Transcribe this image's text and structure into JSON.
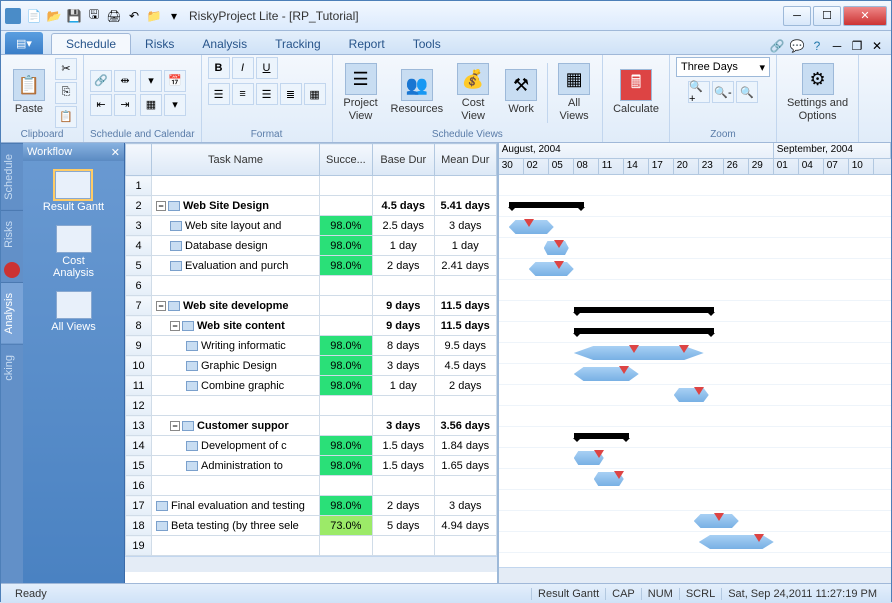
{
  "app": {
    "title": "RiskyProject Lite - [RP_Tutorial]"
  },
  "tabs": {
    "schedule": "Schedule",
    "risks": "Risks",
    "analysis": "Analysis",
    "tracking": "Tracking",
    "report": "Report",
    "tools": "Tools"
  },
  "ribbon": {
    "clipboard": {
      "paste": "Paste",
      "label": "Clipboard"
    },
    "schedcal": {
      "label": "Schedule and Calendar"
    },
    "format": {
      "label": "Format"
    },
    "views": {
      "project": "Project\nView",
      "resources": "Resources",
      "cost": "Cost\nView",
      "work": "Work",
      "all": "All\nViews",
      "label": "Schedule Views"
    },
    "calculate": "Calculate",
    "zoom": {
      "combo": "Three Days",
      "label": "Zoom"
    },
    "settings": {
      "label": "Settings and\nOptions"
    }
  },
  "workflow": {
    "title": "Workflow",
    "gantt": "Result Gantt",
    "cost": "Cost\nAnalysis",
    "all": "All Views"
  },
  "sidetabs": {
    "schedule": "Schedule",
    "risks": "Risks",
    "analysis": "Analysis",
    "cking": "cking"
  },
  "grid": {
    "headers": {
      "task": "Task Name",
      "succ": "Succe...",
      "base": "Base Dur",
      "mean": "Mean Dur"
    },
    "rows": [
      {
        "n": "1",
        "name": "",
        "succ": "",
        "base": "",
        "mean": "",
        "lvl": 0
      },
      {
        "n": "2",
        "name": "Web Site Design",
        "succ": "",
        "base": "4.5 days",
        "mean": "5.41 days",
        "lvl": 0,
        "bold": true,
        "expand": true
      },
      {
        "n": "3",
        "name": "Web site layout and",
        "succ": "98.0%",
        "base": "2.5 days",
        "mean": "3 days",
        "lvl": 1
      },
      {
        "n": "4",
        "name": "Database design",
        "succ": "98.0%",
        "base": "1 day",
        "mean": "1 day",
        "lvl": 1
      },
      {
        "n": "5",
        "name": "Evaluation and purch",
        "succ": "98.0%",
        "base": "2 days",
        "mean": "2.41 days",
        "lvl": 1
      },
      {
        "n": "6",
        "name": "",
        "succ": "",
        "base": "",
        "mean": "",
        "lvl": 0
      },
      {
        "n": "7",
        "name": "Web site developme",
        "succ": "",
        "base": "9 days",
        "mean": "11.5 days",
        "lvl": 0,
        "bold": true,
        "expand": true
      },
      {
        "n": "8",
        "name": "Web site content",
        "succ": "",
        "base": "9 days",
        "mean": "11.5 days",
        "lvl": 1,
        "bold": true,
        "expand": true
      },
      {
        "n": "9",
        "name": "Writing informatic",
        "succ": "98.0%",
        "base": "8 days",
        "mean": "9.5 days",
        "lvl": 2
      },
      {
        "n": "10",
        "name": "Graphic Design",
        "succ": "98.0%",
        "base": "3 days",
        "mean": "4.5 days",
        "lvl": 2
      },
      {
        "n": "11",
        "name": "Combine graphic",
        "succ": "98.0%",
        "base": "1 day",
        "mean": "2 days",
        "lvl": 2
      },
      {
        "n": "12",
        "name": "",
        "succ": "",
        "base": "",
        "mean": "",
        "lvl": 0
      },
      {
        "n": "13",
        "name": "Customer suppor",
        "succ": "",
        "base": "3 days",
        "mean": "3.56 days",
        "lvl": 1,
        "bold": true,
        "expand": true
      },
      {
        "n": "14",
        "name": "Development of c",
        "succ": "98.0%",
        "base": "1.5 days",
        "mean": "1.84 days",
        "lvl": 2
      },
      {
        "n": "15",
        "name": "Administration to",
        "succ": "98.0%",
        "base": "1.5 days",
        "mean": "1.65 days",
        "lvl": 2
      },
      {
        "n": "16",
        "name": "",
        "succ": "",
        "base": "",
        "mean": "",
        "lvl": 0
      },
      {
        "n": "17",
        "name": "Final evaluation and testing",
        "succ": "98.0%",
        "base": "2 days",
        "mean": "3 days",
        "lvl": 0
      },
      {
        "n": "18",
        "name": "Beta testing (by three sele",
        "succ": "73.0%",
        "base": "5 days",
        "mean": "4.94 days",
        "lvl": 0
      },
      {
        "n": "19",
        "name": "",
        "succ": "",
        "base": "",
        "mean": "",
        "lvl": 0
      }
    ]
  },
  "gantt": {
    "months": {
      "aug": "August, 2004",
      "sep": "September, 2004"
    },
    "days": [
      "30",
      "02",
      "05",
      "08",
      "11",
      "14",
      "17",
      "20",
      "23",
      "26",
      "29",
      "01",
      "04",
      "07",
      "10"
    ]
  },
  "status": {
    "ready": "Ready",
    "view": "Result Gantt",
    "cap": "CAP",
    "num": "NUM",
    "scrl": "SCRL",
    "time": "Sat, Sep 24,2011  11:27:19 PM"
  }
}
